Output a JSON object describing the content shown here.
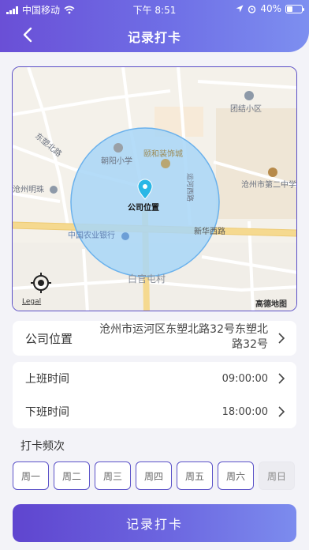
{
  "status_bar": {
    "carrier": "中国移动",
    "time": "下午 8:51",
    "battery": "40%",
    "battery_level": 0.4
  },
  "header": {
    "title": "记录打卡"
  },
  "map": {
    "labels": {
      "tuanjie": "团结小区",
      "dongsu_north": "东塑北路",
      "chaoyang": "朝阳小学",
      "yihe": "颐和装饰城",
      "school2": "沧州市第二中学",
      "mingzhu": "沧州明珠",
      "company": "公司位置",
      "abc_bank": "中国农业银行",
      "xinhua_road": "新华西路",
      "baiguan": "白官屯村",
      "yunhe_road": "运河西路",
      "legal": "Legal",
      "amap": "高德地图"
    }
  },
  "location": {
    "label": "公司位置",
    "address_line1": "沧州市运河区东塑北路32号东塑北",
    "address_line2": "路32号"
  },
  "work_time": {
    "start_label": "上班时间",
    "start_value": "09:00:00",
    "end_label": "下班时间",
    "end_value": "18:00:00"
  },
  "frequency": {
    "title": "打卡频次",
    "days": [
      {
        "label": "周一",
        "selected": true
      },
      {
        "label": "周二",
        "selected": true
      },
      {
        "label": "周三",
        "selected": true
      },
      {
        "label": "周四",
        "selected": true
      },
      {
        "label": "周五",
        "selected": true
      },
      {
        "label": "周六",
        "selected": true
      },
      {
        "label": "周日",
        "selected": false
      }
    ]
  },
  "submit": {
    "label": "记录打卡"
  },
  "colors": {
    "accent": "#5f45cf",
    "accent_light": "#7c8cee",
    "radius_fill": "#a8d6f7",
    "pin": "#2ab7e6"
  }
}
